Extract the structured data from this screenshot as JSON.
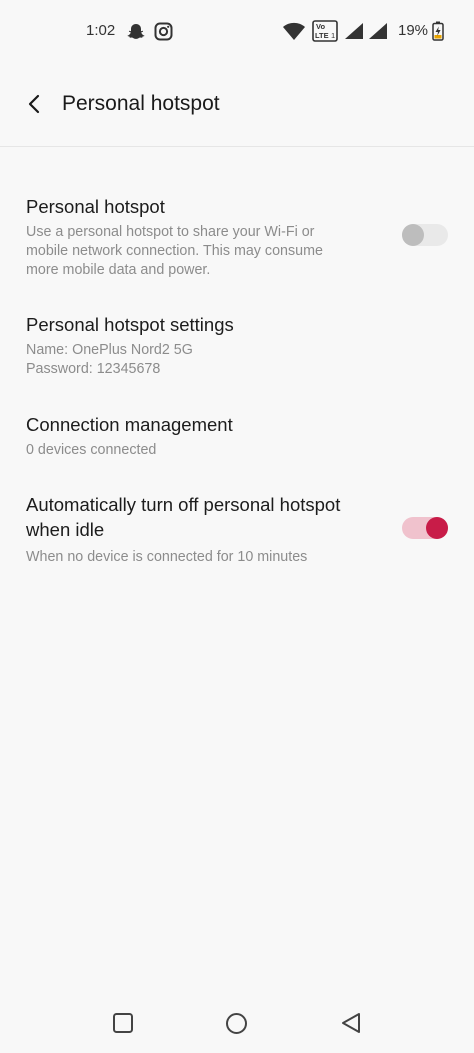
{
  "status_bar": {
    "time": "1:02",
    "battery": "19%",
    "icons": [
      "snapchat-icon",
      "instagram-icon",
      "wifi-icon",
      "volte-icon",
      "signal-icon",
      "signal-icon",
      "battery-charging-icon"
    ]
  },
  "header": {
    "title": "Personal hotspot"
  },
  "settings": {
    "hotspot": {
      "title": "Personal hotspot",
      "description": "Use a personal hotspot to share your Wi-Fi or mobile network connection. This may consume more mobile data and power.",
      "enabled": false
    },
    "hotspot_settings": {
      "title": "Personal hotspot settings",
      "name": "Name: OnePlus Nord2 5G",
      "password": "Password: 12345678"
    },
    "connection": {
      "title": "Connection management",
      "subtitle": "0 devices connected"
    },
    "auto_off": {
      "title": "Automatically turn off personal hotspot when idle",
      "subtitle": "When no device is connected for 10 minutes",
      "enabled": true
    }
  },
  "colors": {
    "accent": "#c81c48",
    "accent_track": "#f0c2cd",
    "background": "#f8f8f8"
  }
}
